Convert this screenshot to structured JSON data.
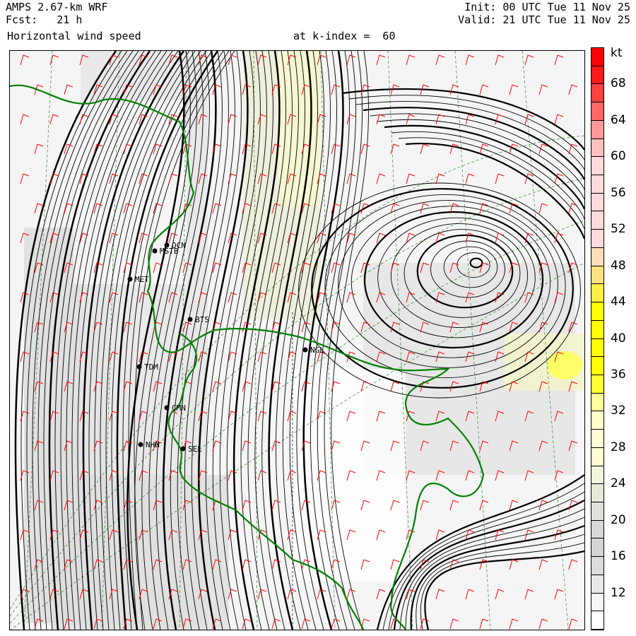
{
  "header": {
    "model": "AMPS 2.67-km WRF",
    "forecast": "Fcst:   21 h",
    "field": "Horizontal wind speed",
    "level": "at k-index =  60",
    "init": "Init: 00 UTC Tue 11 Nov 25",
    "valid": "Valid: 21 UTC Tue 11 Nov 25"
  },
  "colorbar": {
    "unit": "kt",
    "labels": [
      "68",
      "64",
      "60",
      "56",
      "52",
      "48",
      "44",
      "40",
      "36",
      "32",
      "28",
      "24",
      "20",
      "16",
      "12"
    ],
    "colors": [
      "#ff0000",
      "#ff1a1a",
      "#ff4040",
      "#ff6666",
      "#ff9999",
      "#ffc0c0",
      "#ffdada",
      "#ffdada",
      "#ffdada",
      "#ffdada",
      "#ffdada",
      "#ffddbb",
      "#ffe080",
      "#ffee44",
      "#ffff00",
      "#ffff00",
      "#ffff00",
      "#ffff00",
      "#ffff33",
      "#ffff99",
      "#ffffcc",
      "#ffffd4",
      "#ffffd4",
      "#f5f5dc",
      "#e8e8d8",
      "#e0e0dc",
      "#d8d8d8",
      "#d4d4d4",
      "#dcdcdc",
      "#e8e8e8",
      "#f5f5f5",
      "#ffffff"
    ]
  },
  "map": {
    "coast_color": "#008000",
    "barb_color": "#ff0000",
    "stations": [
      {
        "id": "OCN"
      },
      {
        "id": "MSTB"
      },
      {
        "id": "MET"
      },
      {
        "id": "BTS"
      },
      {
        "id": "TDM"
      },
      {
        "id": "CMN"
      },
      {
        "id": "NHN"
      },
      {
        "id": "SEL"
      },
      {
        "id": "NGL"
      }
    ]
  }
}
